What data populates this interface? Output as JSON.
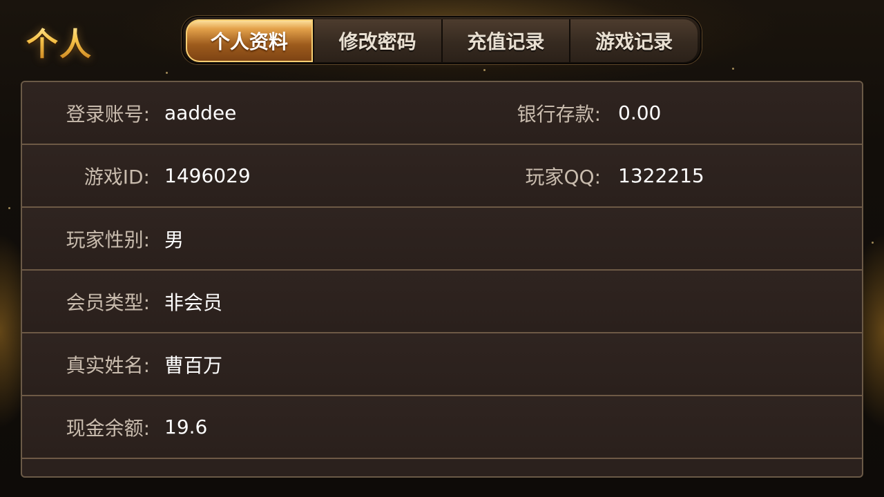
{
  "header": {
    "title": "个人"
  },
  "tabs": [
    {
      "label": "个人资料",
      "active": true
    },
    {
      "label": "修改密码",
      "active": false
    },
    {
      "label": "充值记录",
      "active": false
    },
    {
      "label": "游戏记录",
      "active": false
    }
  ],
  "profile": {
    "rows": [
      {
        "label": "登录账号:",
        "value": "aaddee",
        "label2": "银行存款:",
        "value2": "0.00"
      },
      {
        "label": "游戏ID:",
        "value": "1496029",
        "label2": "玩家QQ:",
        "value2": "1322215"
      },
      {
        "label": "玩家性别:",
        "value": "男"
      },
      {
        "label": "会员类型:",
        "value": "非会员"
      },
      {
        "label": "真实姓名:",
        "value": "曹百万"
      },
      {
        "label": "现金余额:",
        "value": "19.6"
      }
    ]
  },
  "colors": {
    "accent_gold": "#f6c34a",
    "panel_bg": "#2b211d",
    "row_divider": "#6e5a46",
    "label_text": "#c9bcae",
    "value_text": "#ffffff"
  }
}
